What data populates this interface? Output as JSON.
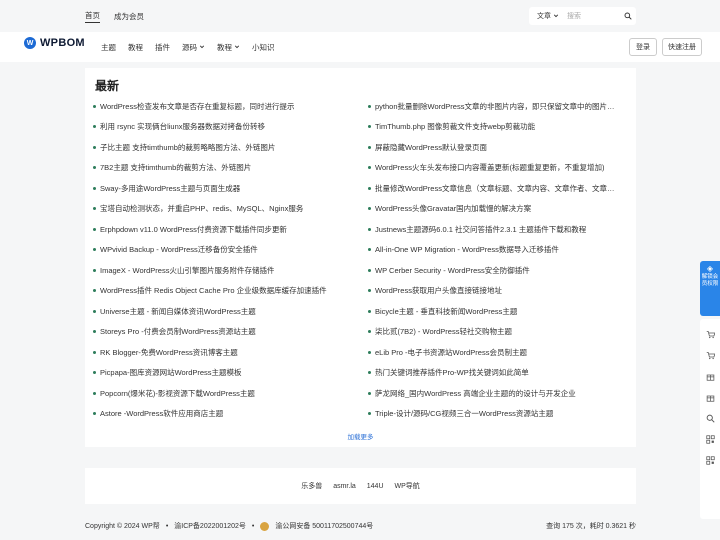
{
  "topbar": {
    "links": [
      "首页",
      "成为会员"
    ],
    "search_type": "文章",
    "search_placeholder": "搜索"
  },
  "brand": {
    "logo_mark": "W",
    "logo_text": "WPBOM"
  },
  "nav": {
    "items": [
      {
        "label": "主题",
        "dropdown": false
      },
      {
        "label": "教程",
        "dropdown": false
      },
      {
        "label": "插件",
        "dropdown": false
      },
      {
        "label": "源码",
        "dropdown": true
      },
      {
        "label": "教程",
        "dropdown": true
      },
      {
        "label": "小知识",
        "dropdown": false
      }
    ],
    "login": "登录",
    "register": "快速注册"
  },
  "main": {
    "title": "最新",
    "left": [
      "WordPress检查发布文章是否存在重复标题，同时进行提示",
      "利用 rsync 实现俩台liunx服务器数据对拷备份转移",
      "子比主题 支持timthumb的裁剪略略图方法、外链图片",
      "7B2主题 支持timthumb的裁剪方法、外链图片",
      "Sway-多用途WordPress主题与页面生成器",
      "宝塔自动检测状态，并重启PHP、redis、MySQL、Nginx服务",
      "Erphpdown v11.0 WordPress付费资源下载插件同步更新",
      "WPvivid Backup - WordPress迁移备份安全插件",
      "ImageX - WordPress火山引擎图片服务附件存储插件",
      "WordPress插件 Redis Object Cache Pro 企业级数据库缓存加速插件",
      "Universe主题 - 新闻自媒体资讯WordPress主题",
      "Storeys Pro -付费会员制WordPress资源站主题",
      "RK Blogger-免费WordPress资讯博客主题",
      "Picpapa-图库资源网站WordPress主题模板",
      "Popcorn(爆米花)-影视资源下载WordPress主题",
      "Astore -WordPress软件应用商店主题"
    ],
    "right": [
      "python批量删除WordPress文章的非图片内容，即只保留文章中的图片…",
      "TimThumb.php 图像剪裁文件支持webp剪裁功能",
      "屏蔽隐藏WordPress默认登录页面",
      "WordPress火车头发布接口内容覆盖更新(标题重复更新，不重复增加)",
      "批量修改WordPress文章信息（文章标题、文章内容、文章作者、文章…",
      "WordPress头像Gravatar国内加载慢的解决方案",
      "Justnews主题源码6.0.1 社交问答插件2.3.1 主题插件下载和教程",
      "All-in-One WP Migration - WordPress数据导入迁移插件",
      "WP Cerber Security - WordPress安全防御插件",
      "WordPress获取用户头像直接链接地址",
      "Bicycle主题 - 垂直科技新闻WordPress主题",
      "柒比贰(7B2) - WordPress轻社交购物主题",
      "eLib Pro -电子书资源站WordPress会员制主题",
      "热门关键词推荐插件Pro-WP找关键词如此简单",
      "萨龙网络_国内WordPress 高端企业主题的的设计与开发企业",
      "Triple-设计/源码/CG视频三合一WordPress资源站主题"
    ],
    "load_more": "加载更多"
  },
  "friend_links": [
    "乐多兽",
    "asmr.la",
    "144U",
    "WP导航"
  ],
  "footer": {
    "copyright": "Copyright © 2024 WP帮",
    "icp": "渝ICP备2022001202号",
    "police": "渝公网安备 50011702500744号",
    "stats": "查询 175 次，耗时 0.3621 秒"
  },
  "float_bar": {
    "vip_label": "解锁会员权限",
    "tools": [
      "cart-icon",
      "cart-icon",
      "gift-icon",
      "gift-icon",
      "search-icon",
      "qrcode-icon",
      "qrcode-icon"
    ]
  },
  "colors": {
    "accent": "#2a85e8",
    "bullet": "#2e7d5b",
    "link": "#2a6fd6"
  }
}
